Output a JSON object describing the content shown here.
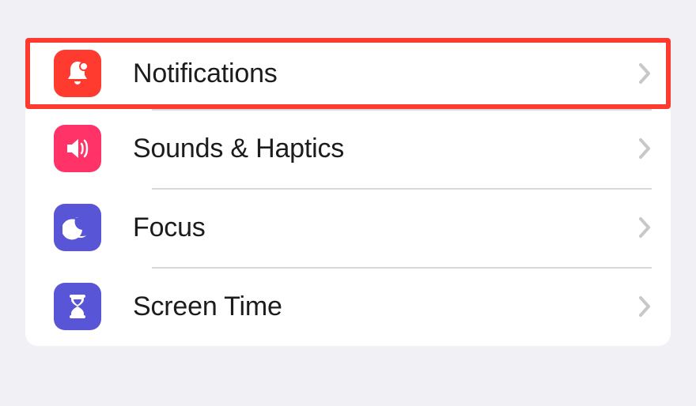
{
  "rows": [
    {
      "label": "Notifications",
      "icon": "bell-icon",
      "highlighted": true
    },
    {
      "label": "Sounds & Haptics",
      "icon": "speaker-icon",
      "highlighted": false
    },
    {
      "label": "Focus",
      "icon": "moon-icon",
      "highlighted": false
    },
    {
      "label": "Screen Time",
      "icon": "hourglass-icon",
      "highlighted": false
    }
  ],
  "colors": {
    "highlight_border": "#ff3b30",
    "notifications_tile": "#ff3b30",
    "sounds_tile": "#ff3367",
    "focus_tile": "#5856d6",
    "screentime_tile": "#5856d6",
    "chevron": "#c7c7cc"
  }
}
